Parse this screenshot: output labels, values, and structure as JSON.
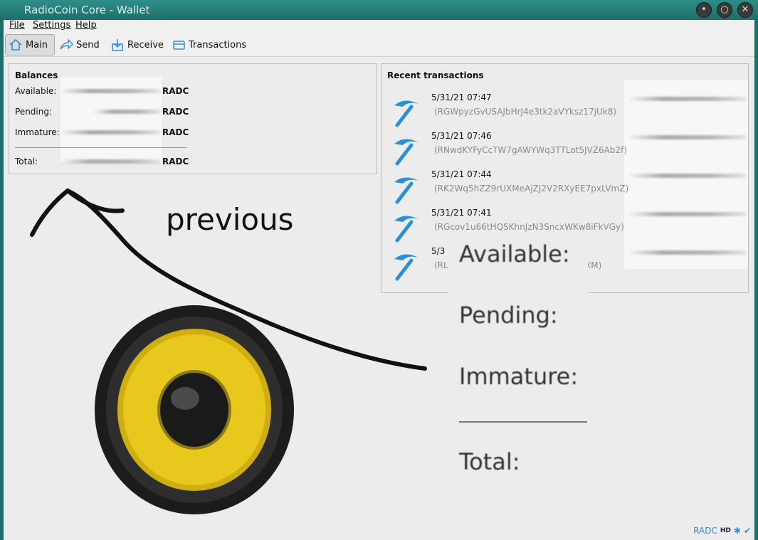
{
  "window": {
    "title": "RadioCoin Core - Wallet"
  },
  "menu": {
    "file": "File",
    "settings": "Settings",
    "help": "Help"
  },
  "toolbar": {
    "main": "Main",
    "send": "Send",
    "receive": "Receive",
    "transactions": "Transactions"
  },
  "balances": {
    "title": "Balances",
    "available_label": "Available:",
    "pending_label": "Pending:",
    "immature_label": "Immature:",
    "total_label": "Total:",
    "unit": "RADC"
  },
  "recent": {
    "title": "Recent transactions",
    "items": [
      {
        "date": "5/31/21 07:47",
        "address": "(RGWpyzGvUSAJbHrJ4e3tk2aVYksz17jUk8)"
      },
      {
        "date": "5/31/21 07:46",
        "address": "(RNwdKYFyCcTW7gAWYWq3TTLot5JVZ6Ab2f)"
      },
      {
        "date": "5/31/21 07:44",
        "address": "(RK2Wq5hZZ9rUXMeAjZJ2V2RXyEE7pxLVmZ)"
      },
      {
        "date": "5/31/21 07:41",
        "address": "(RGcov1u66tHQSKhnJzN3SncxWKw8iFkVGy)"
      },
      {
        "date": "5/3",
        "address": "(RL",
        "address_tail": "XM)"
      }
    ]
  },
  "overlay": {
    "previous": "previous",
    "labels": [
      "Available:",
      "Pending:",
      "Immature:",
      "Total:"
    ]
  },
  "status": {
    "unit": "RADC",
    "hd": "HD"
  },
  "colors": {
    "titlebar": "#1d6e6a",
    "accent": "#2a8fd6",
    "speaker_cone": "#e8c81d"
  }
}
